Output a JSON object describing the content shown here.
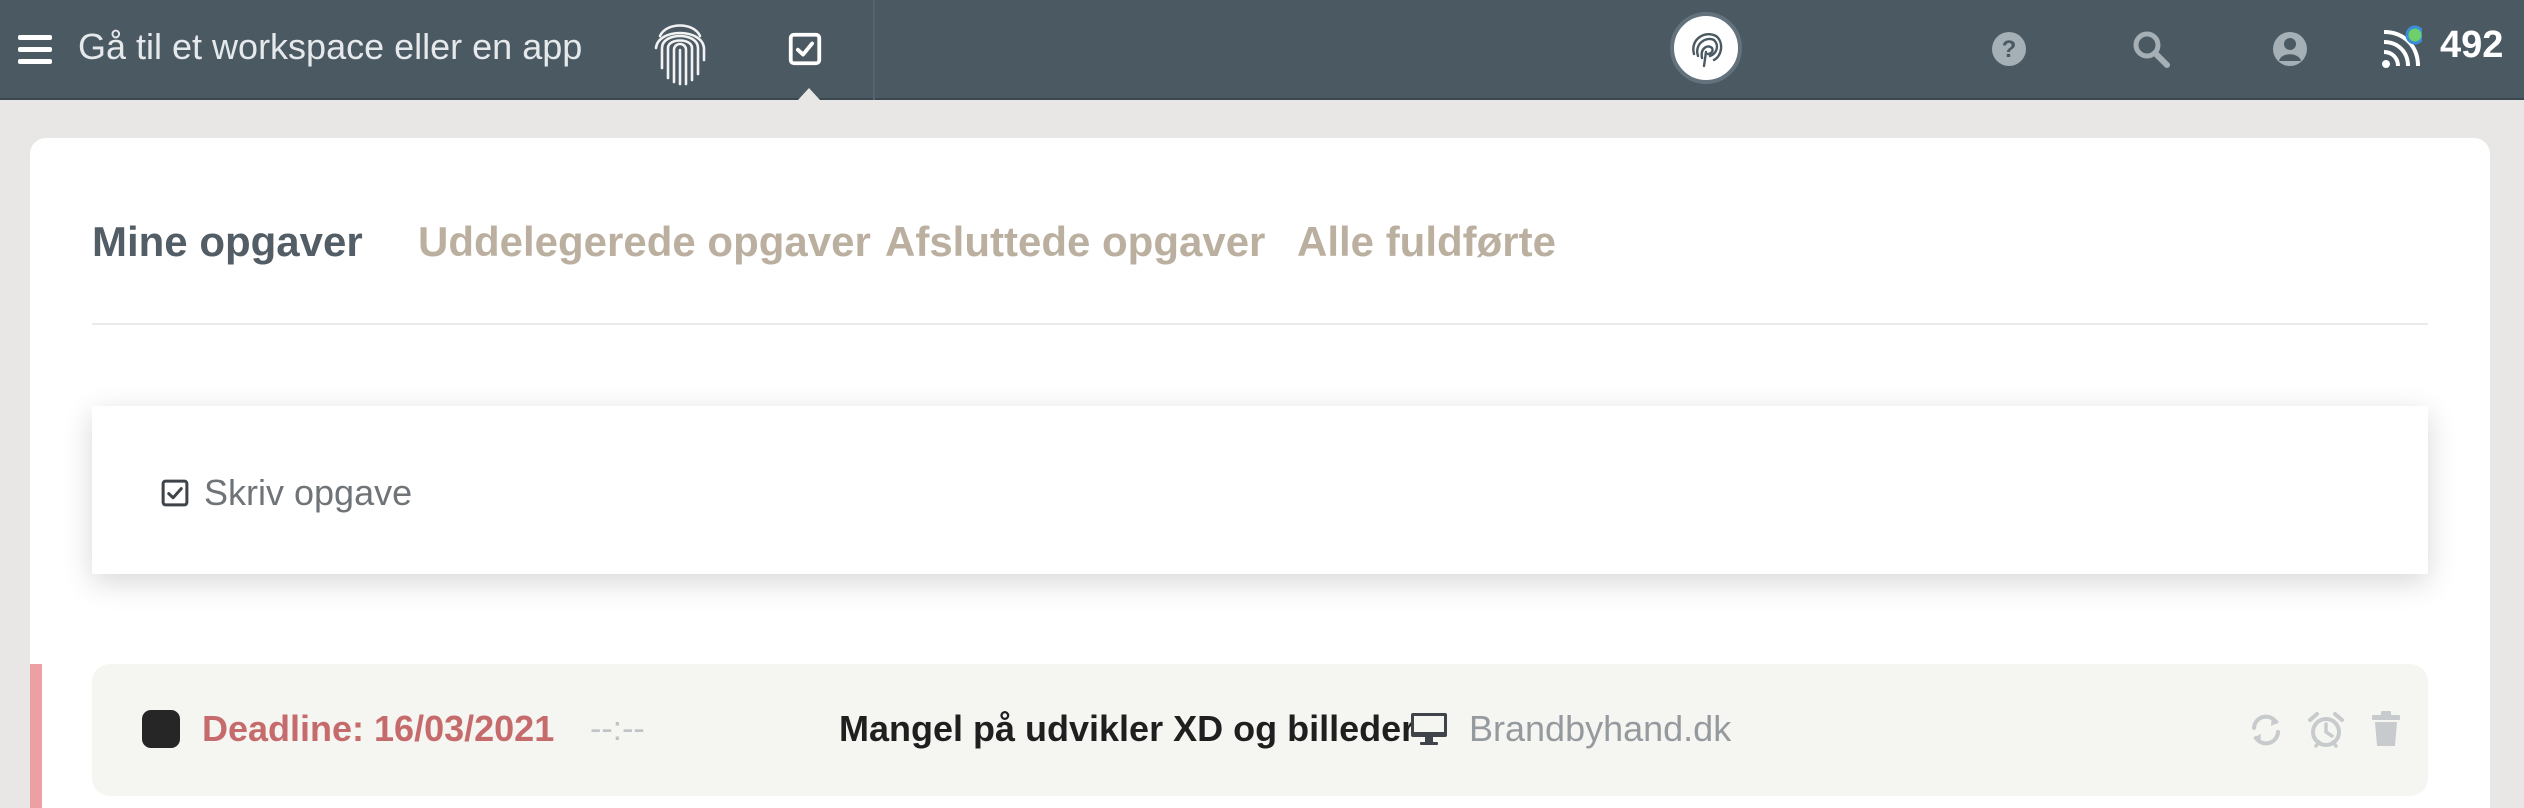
{
  "topbar": {
    "search_label": "Gå til et workspace eller en app",
    "notification_count": "492"
  },
  "tabs": [
    {
      "label": "Mine opgaver",
      "active": true
    },
    {
      "label": "Uddelegerede opgaver",
      "active": false
    },
    {
      "label": "Afsluttede opgaver",
      "active": false
    },
    {
      "label": "Alle fuldførte",
      "active": false
    }
  ],
  "new_task": {
    "placeholder": "Skriv opgave"
  },
  "tasks": [
    {
      "deadline": "Deadline: 16/03/2021",
      "time": "--:--",
      "title": "Mangel på udvikler XD og billeder",
      "project": "Brandbyhand.dk"
    }
  ],
  "colors": {
    "topbar": "#4b5963",
    "active_tab": "#525d66",
    "inactive_tab": "#bbb0a0",
    "deadline": "#c56b6b",
    "priority": "#eda0a3"
  }
}
